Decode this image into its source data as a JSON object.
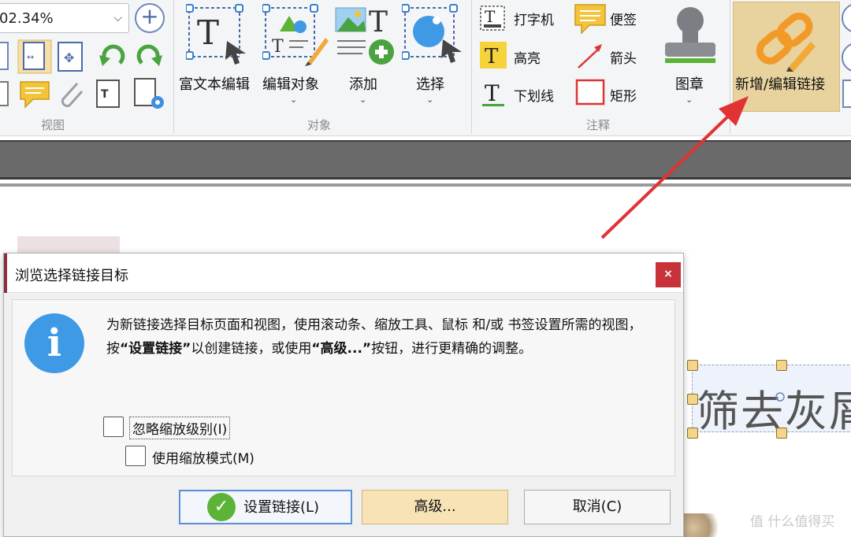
{
  "ribbon": {
    "zoom_value": "02.34%",
    "groups": {
      "view_label": "视图",
      "object_label": "对象",
      "annotation_label": "注释"
    },
    "tools": {
      "rich_text_edit": "富文本编辑",
      "edit_object": "编辑对象",
      "add": "添加",
      "select": "选择",
      "typewriter": "打字机",
      "sticky_note": "便签",
      "highlight": "高亮",
      "arrow": "箭头",
      "underline": "下划线",
      "rectangle": "矩形",
      "stamp": "图章",
      "add_edit_link": "新增/编辑链接"
    }
  },
  "document": {
    "selected_text": "筛去灰屑"
  },
  "dialog": {
    "title": "浏览选择链接目标",
    "close_label": "×",
    "message_part1": "为新链接选择目标页面和视图，使用滚动条、缩放工具、鼠标 和/或 书签设置所需的视图，按",
    "message_bold1": "“设置链接”",
    "message_part2": "以创建链接，或使用",
    "message_bold2": "“高级...”",
    "message_part3": "按钮，进行更精确的调整。",
    "checkbox_ignore_zoom": "忽略缩放级别(I)",
    "checkbox_use_zoom_mode": "使用缩放模式(M)",
    "btn_set_link": "设置链接(L)",
    "btn_advanced": "高级...",
    "btn_cancel": "取消(C)"
  },
  "watermark": "值 什么值得买",
  "colors": {
    "accent_highlight": "#e8d29d",
    "info_icon": "#3f9ae6",
    "arrow_red": "#e03434",
    "success_green": "#5cb337",
    "close_red": "#c7323a"
  }
}
